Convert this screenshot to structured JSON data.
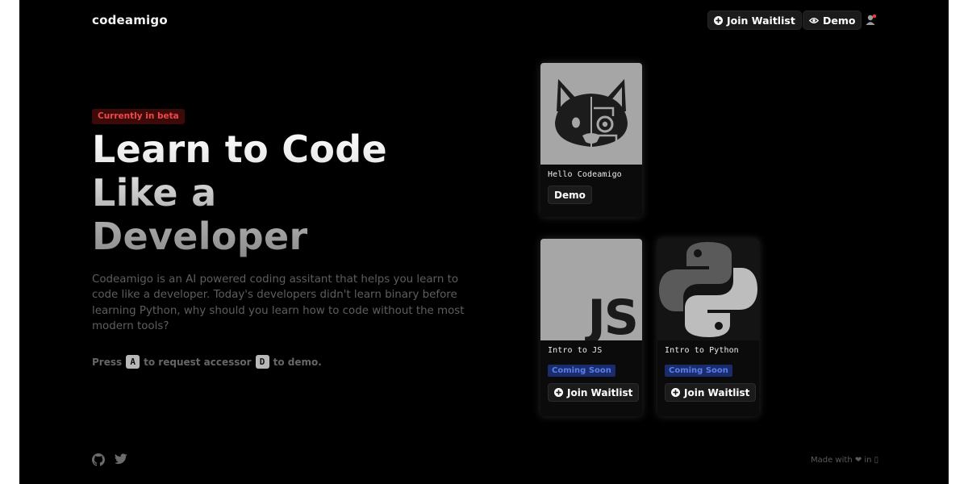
{
  "header": {
    "brand": "codeamigo",
    "waitlist_label": "Join Waitlist",
    "demo_label": "Demo"
  },
  "hero": {
    "badge": "Currently in beta",
    "headline": "Learn to Code Like a Developer",
    "description": "Codeamigo is an AI powered coding assitant that helps you learn to code like a developer. Today's developers didn't learn binary before learning Python, why should you learn how to code without the most modern tools?",
    "shortcut": {
      "press": "Press",
      "key_access": "A",
      "middle": "to request accessor",
      "key_demo": "D",
      "end": "to demo."
    }
  },
  "cards": [
    {
      "title": "Hello Codeamigo",
      "button": "Demo",
      "icon": "dog-robot-logo"
    },
    {
      "title": "Intro to JS",
      "badge": "Coming Soon",
      "button": "Join Waitlist",
      "icon": "js-logo"
    },
    {
      "title": "Intro to Python",
      "badge": "Coming Soon",
      "button": "Join Waitlist",
      "icon": "python-logo"
    }
  ],
  "footer": {
    "made_with": "Made with ❤ in ▯",
    "icons": [
      "github-icon",
      "twitter-icon"
    ]
  },
  "colors": {
    "background": "#000000",
    "beta_badge_bg": "#3d0a0a",
    "beta_badge_text": "#f04747",
    "coming_soon_bg": "#1a2c6b",
    "coming_soon_text": "#5b7fe8"
  }
}
